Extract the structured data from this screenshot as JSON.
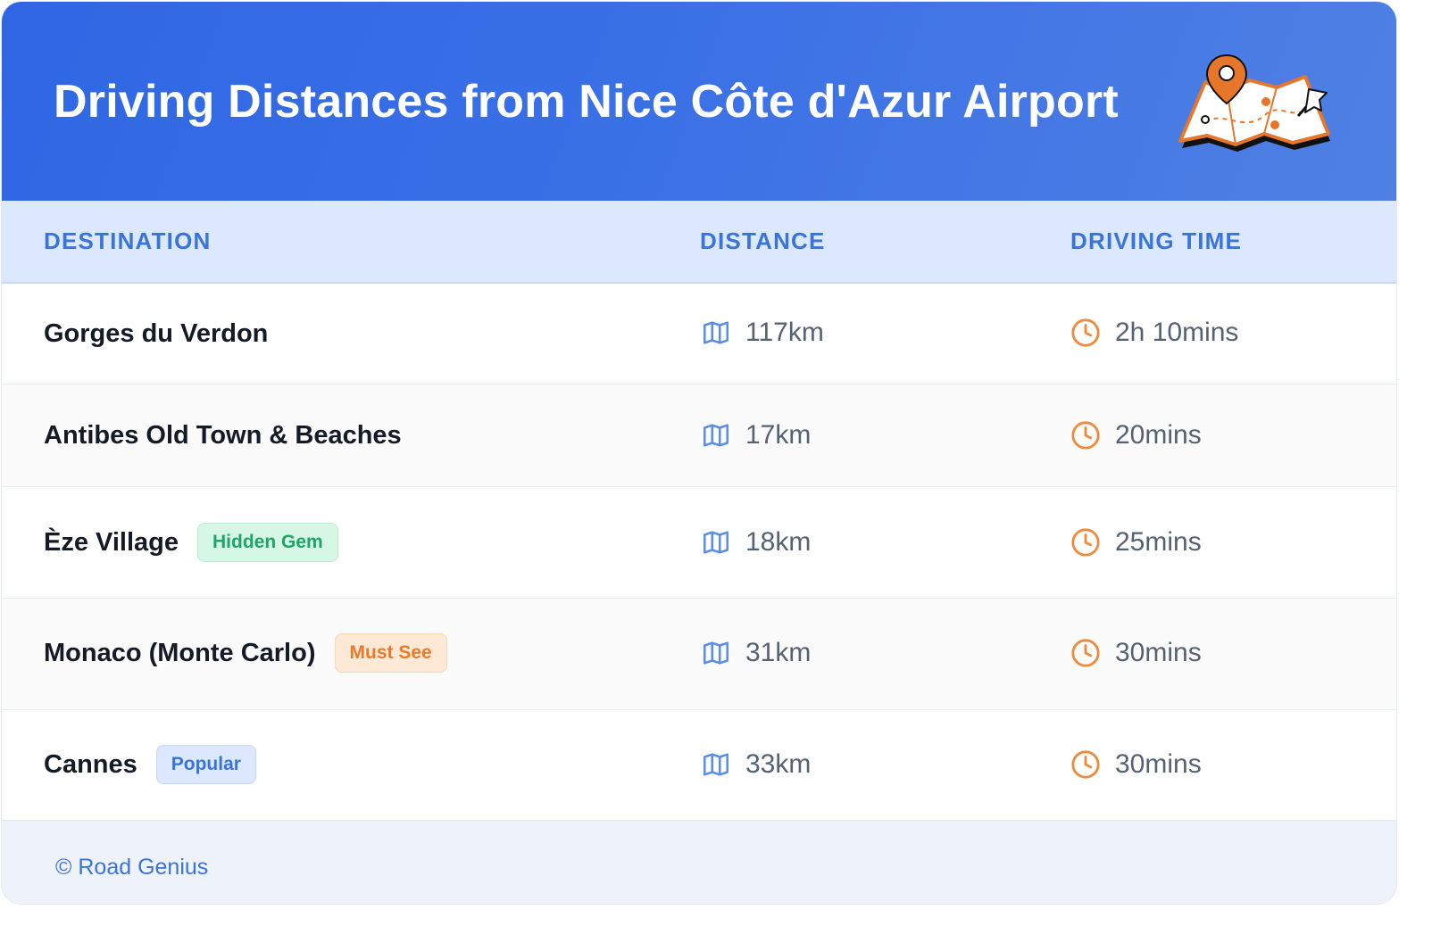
{
  "header": {
    "title": "Driving Distances from Nice Côte d'Azur Airport",
    "illustration": "map-with-pins-icon"
  },
  "table": {
    "columns": [
      "DESTINATION",
      "DISTANCE",
      "DRIVING TIME"
    ],
    "rows": [
      {
        "destination": "Gorges du Verdon",
        "badge": "",
        "distance": "117km",
        "time": "2h 10mins"
      },
      {
        "destination": "Antibes Old Town & Beaches",
        "badge": "",
        "distance": "17km",
        "time": "20mins"
      },
      {
        "destination": "Èze Village",
        "badge": "Hidden Gem",
        "badge_color": "#1fa565",
        "distance": "18km",
        "time": "25mins"
      },
      {
        "destination": "Monaco (Monte Carlo)",
        "badge": "Must See",
        "badge_color": "#ea7a2a",
        "distance": "31km",
        "time": "30mins"
      },
      {
        "destination": "Cannes",
        "badge": "Popular",
        "badge_color": "#3a74db",
        "distance": "33km",
        "time": "30mins"
      }
    ],
    "distance_icon": "map-icon",
    "time_icon": "clock-icon"
  },
  "footer": {
    "credit": "© Road Genius"
  },
  "colors": {
    "header_bg": "#2f66e4",
    "accent": "#3a74db",
    "distance_icon": "#5b8ee6",
    "time_icon": "#ee8a3c"
  }
}
